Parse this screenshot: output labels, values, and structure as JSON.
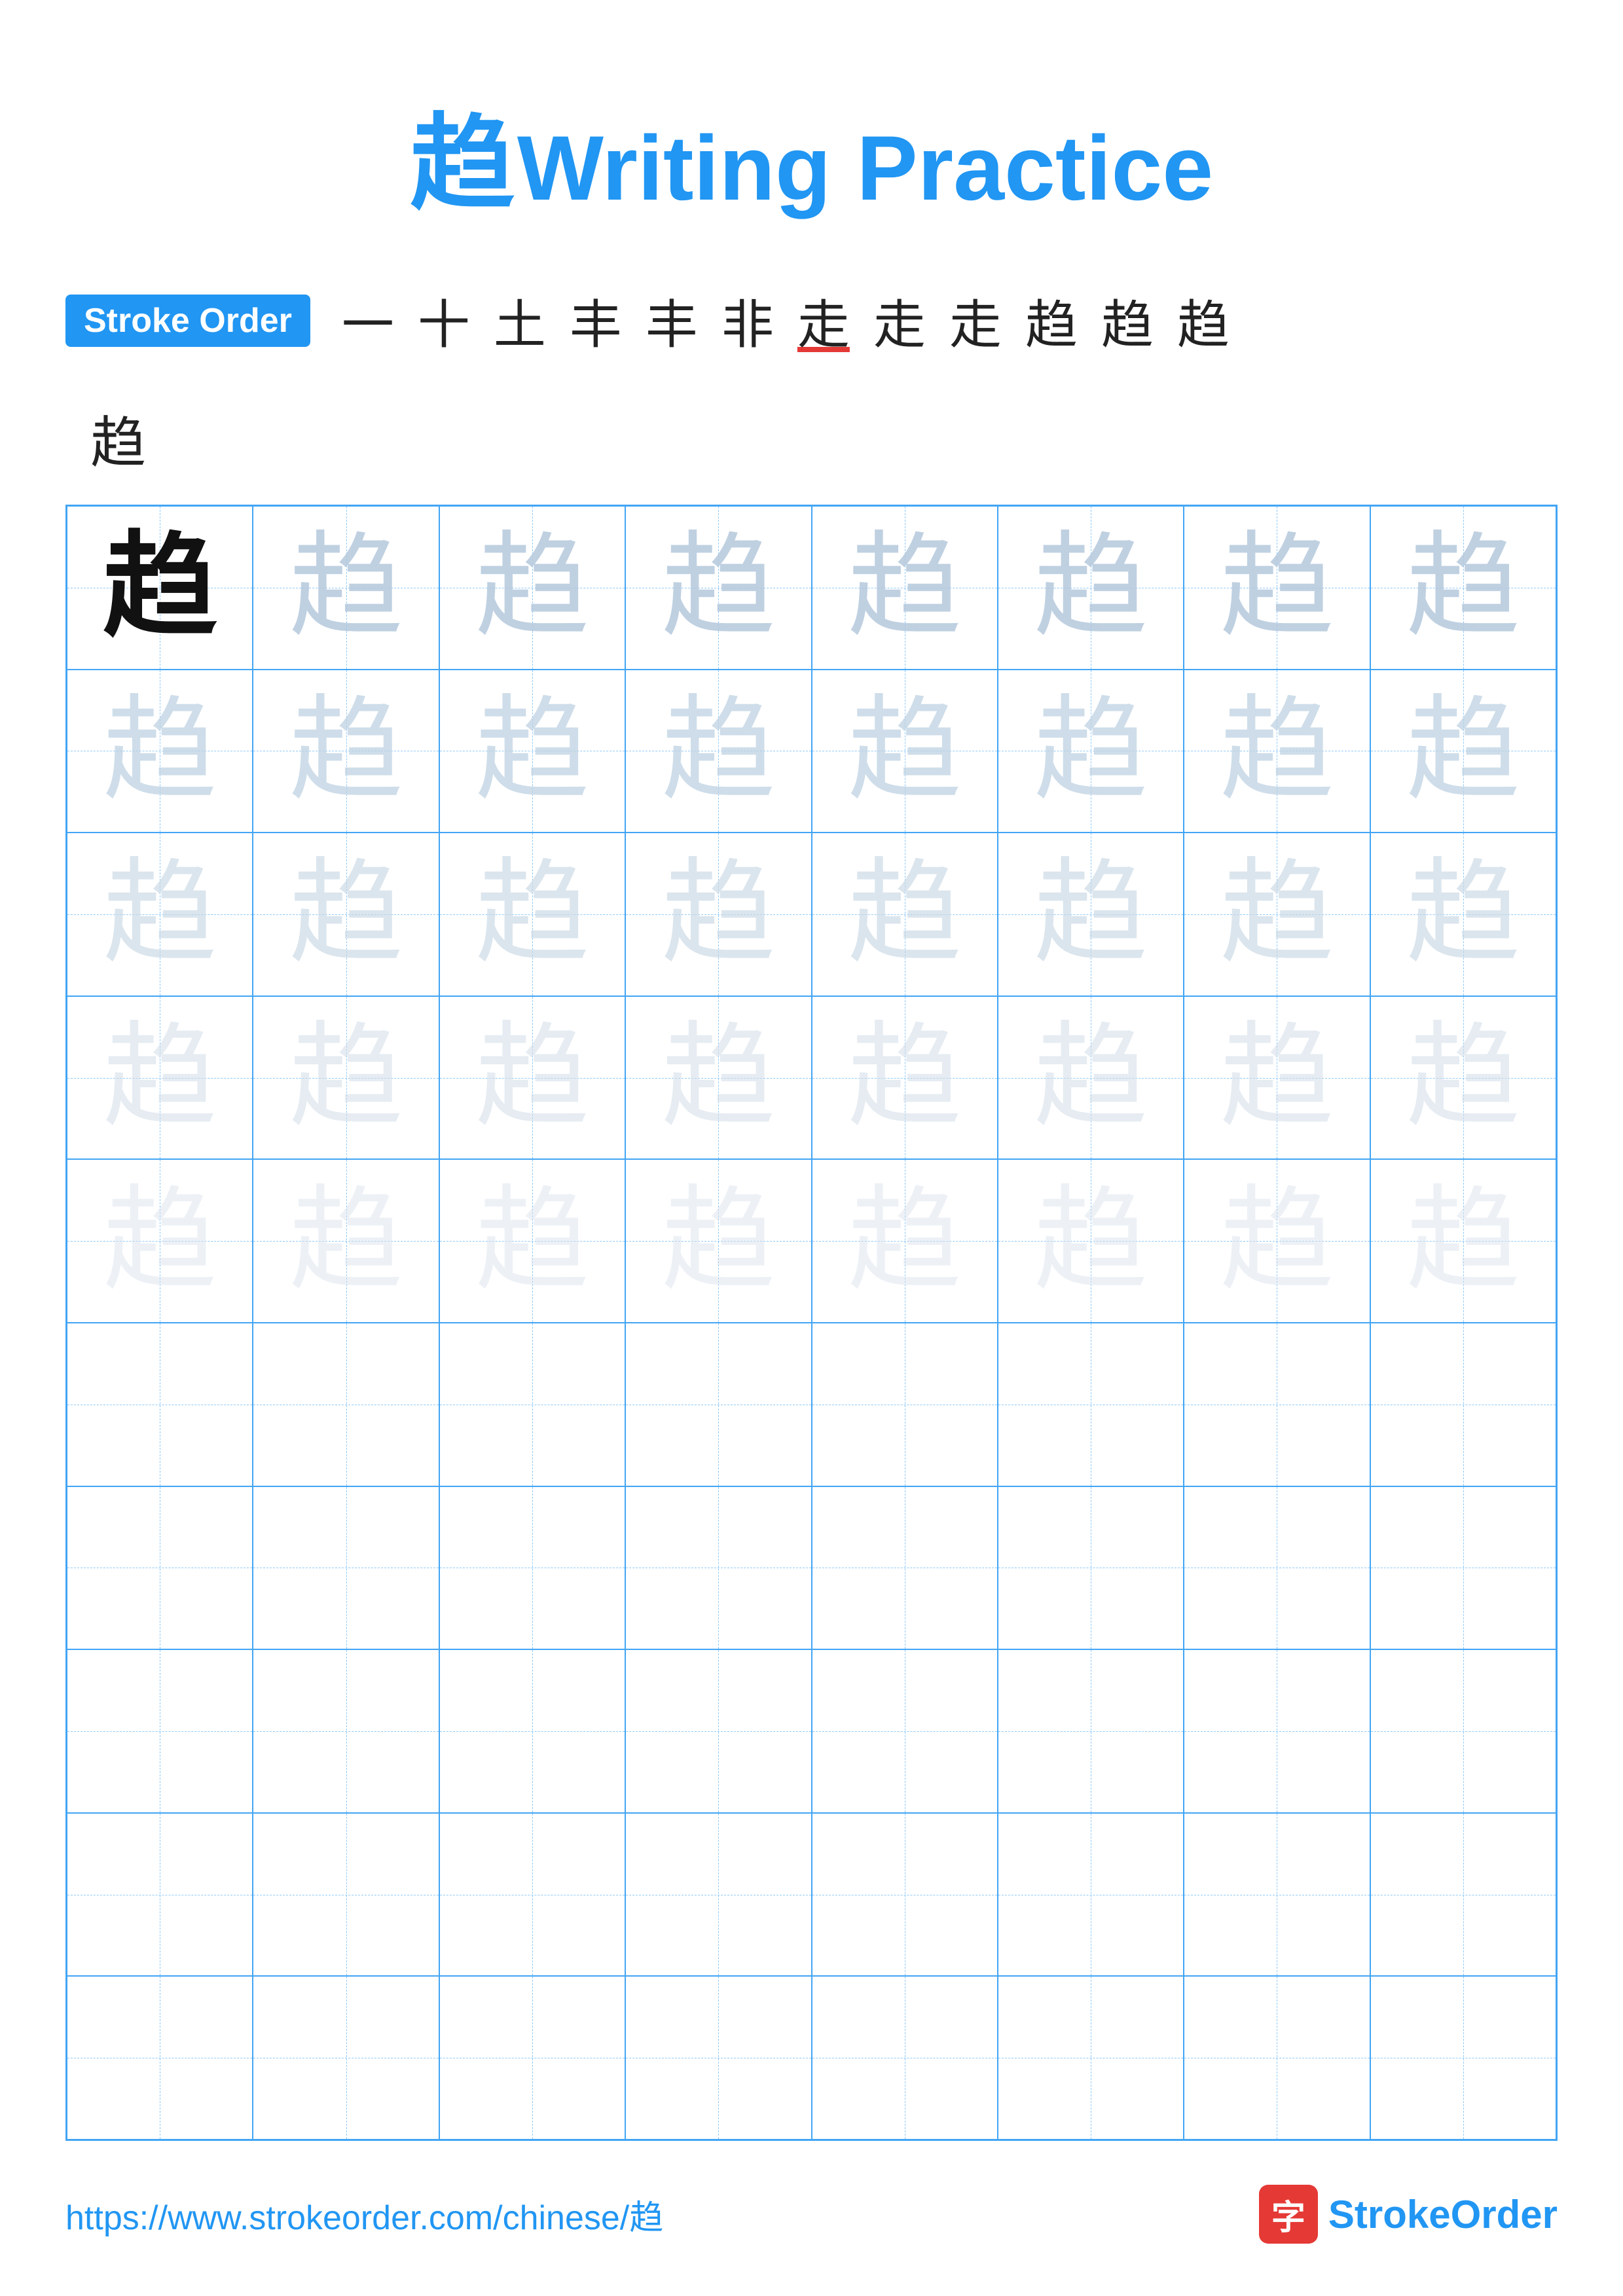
{
  "title": {
    "char": "趋",
    "text": "Writing Practice"
  },
  "stroke_order": {
    "badge_label": "Stroke Order",
    "steps": [
      "一",
      "十",
      "土",
      "丰",
      "丰",
      "非",
      "走",
      "走",
      "走",
      "趋",
      "趋",
      "趋"
    ],
    "line2_char": "趋"
  },
  "grid": {
    "rows": 10,
    "cols": 8,
    "char": "趋",
    "filled_rows": 5
  },
  "footer": {
    "url": "https://www.strokeorder.com/chinese/趋",
    "logo_char": "字",
    "logo_text_part1": "Stroke",
    "logo_text_part2": "Order"
  }
}
